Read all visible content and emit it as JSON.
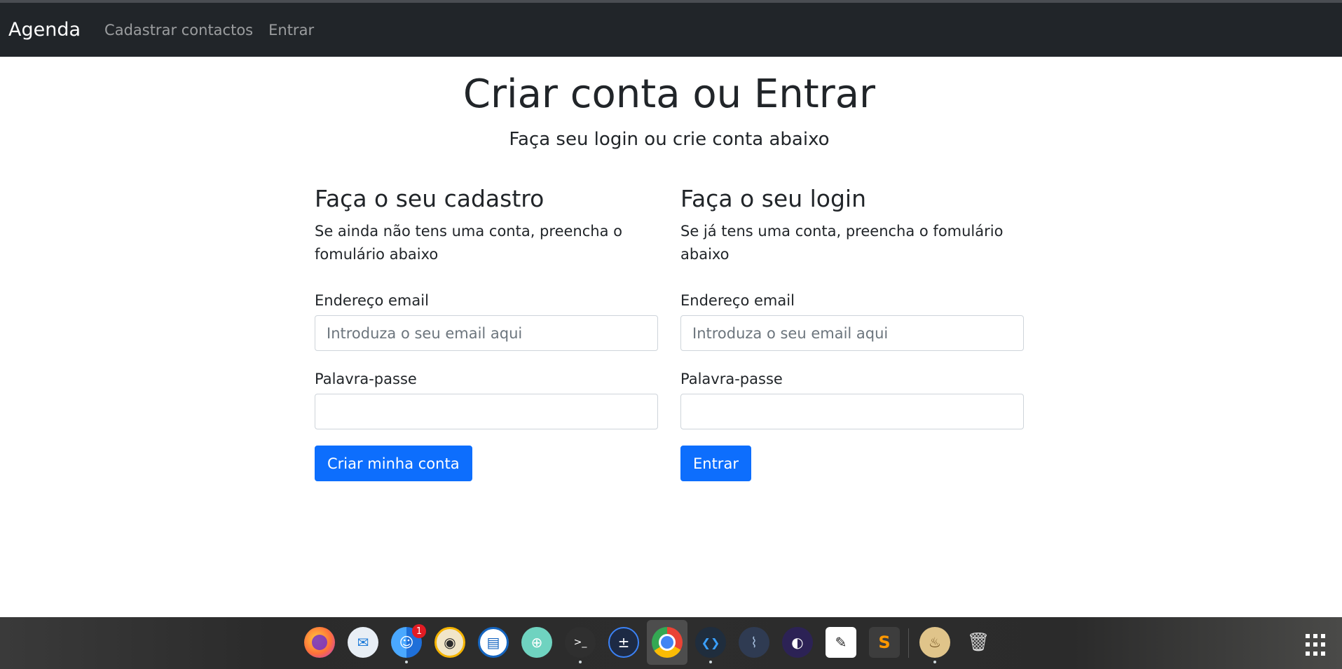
{
  "navbar": {
    "brand": "Agenda",
    "links": [
      {
        "label": "Cadastrar contactos"
      },
      {
        "label": "Entrar"
      }
    ]
  },
  "hero": {
    "title": "Criar conta ou Entrar",
    "subtitle": "Faça seu login ou crie conta abaixo"
  },
  "signup": {
    "heading": "Faça o seu cadastro",
    "description": "Se ainda não tens uma conta, preencha o fomulário abaixo",
    "email_label": "Endereço email",
    "email_placeholder": "Introduza o seu email aqui",
    "email_value": "",
    "password_label": "Palavra-passe",
    "password_value": "",
    "submit_label": "Criar minha conta"
  },
  "login": {
    "heading": "Faça o seu login",
    "description": "Se já tens uma conta, preencha o fomulário abaixo",
    "email_label": "Endereço email",
    "email_placeholder": "Introduza o seu email aqui",
    "email_value": "",
    "password_label": "Palavra-passe",
    "password_value": "",
    "submit_label": "Entrar"
  },
  "colors": {
    "navbar_bg": "#212529",
    "primary": "#0d6efd",
    "text": "#212529"
  },
  "dock": {
    "items": [
      {
        "name": "firefox-icon",
        "glyph": "",
        "badge": ""
      },
      {
        "name": "mail-icon",
        "glyph": "✉",
        "badge": ""
      },
      {
        "name": "finder-icon",
        "glyph": "☺",
        "badge": "1"
      },
      {
        "name": "speaker-icon",
        "glyph": "◉",
        "badge": ""
      },
      {
        "name": "document-viewer-icon",
        "glyph": "▤",
        "badge": ""
      },
      {
        "name": "help-lifebuoy-icon",
        "glyph": "⊕",
        "badge": ""
      },
      {
        "name": "terminal-icon",
        "glyph": ">_",
        "badge": ""
      },
      {
        "name": "calculator-icon",
        "glyph": "±",
        "badge": ""
      },
      {
        "name": "chrome-icon",
        "glyph": "",
        "badge": ""
      },
      {
        "name": "vscode-icon",
        "glyph": "❮❯",
        "badge": ""
      },
      {
        "name": "mysql-workbench-icon",
        "glyph": "⌇",
        "badge": ""
      },
      {
        "name": "eclipse-icon",
        "glyph": "◐",
        "badge": ""
      },
      {
        "name": "inkscape-icon",
        "glyph": "✎",
        "badge": ""
      },
      {
        "name": "sublime-text-icon",
        "glyph": "S",
        "badge": ""
      },
      {
        "name": "archive-icon",
        "glyph": "♨",
        "badge": ""
      },
      {
        "name": "trash-icon",
        "glyph": "🗑",
        "badge": ""
      }
    ]
  }
}
